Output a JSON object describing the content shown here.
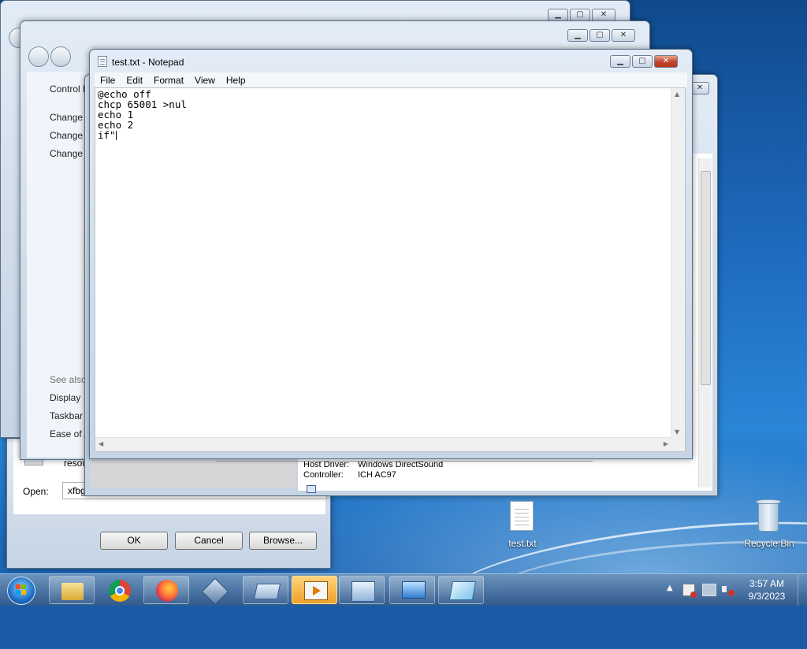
{
  "control_panel": {
    "breadcrumb": "Control P",
    "links": [
      "Change c",
      "Change r",
      "Change y"
    ],
    "see_also": "See also",
    "see_also_links": [
      "Display",
      "Taskbar a",
      "Ease of A"
    ]
  },
  "run_dialog": {
    "partial_text": "resou",
    "open_label": "Open:",
    "open_value": "xfbg",
    "ok": "OK",
    "cancel": "Cancel",
    "browse": "Browse..."
  },
  "dxdiag": {
    "host_driver_label": "Host Driver:",
    "host_driver_value": "Windows DirectSound",
    "controller_label": "Controller:",
    "controller_value": "ICH AC97"
  },
  "notepad": {
    "title": "test.txt - Notepad",
    "menu": [
      "File",
      "Edit",
      "Format",
      "View",
      "Help"
    ],
    "lines": [
      "@echo off",
      "chcp 65001 >nul",
      "echo 1",
      "echo 2",
      "if\""
    ]
  },
  "desktop": {
    "icons": [
      {
        "label": "test.txt",
        "icon": "text-file-icon"
      },
      {
        "label": "Recycle Bin",
        "icon": "recycle-bin-icon"
      }
    ]
  },
  "taskbar": {
    "buttons": [
      "windows-explorer-icon",
      "chrome-icon",
      "firefox-icon",
      "virtualbox-icon",
      "run-icon",
      "media-icon",
      "control-panel-icon",
      "dxdiag-icon",
      "notepad-icon"
    ],
    "tray_icons": [
      "show-hidden-icons-icon",
      "action-center-icon",
      "network-icon",
      "volume-muted-icon"
    ],
    "time": "3:57 AM",
    "date": "9/3/2023"
  },
  "colors": {
    "desktop": "#1f6bc0",
    "taskbar": "#3a6a9c",
    "close_button": "#c0432b"
  }
}
